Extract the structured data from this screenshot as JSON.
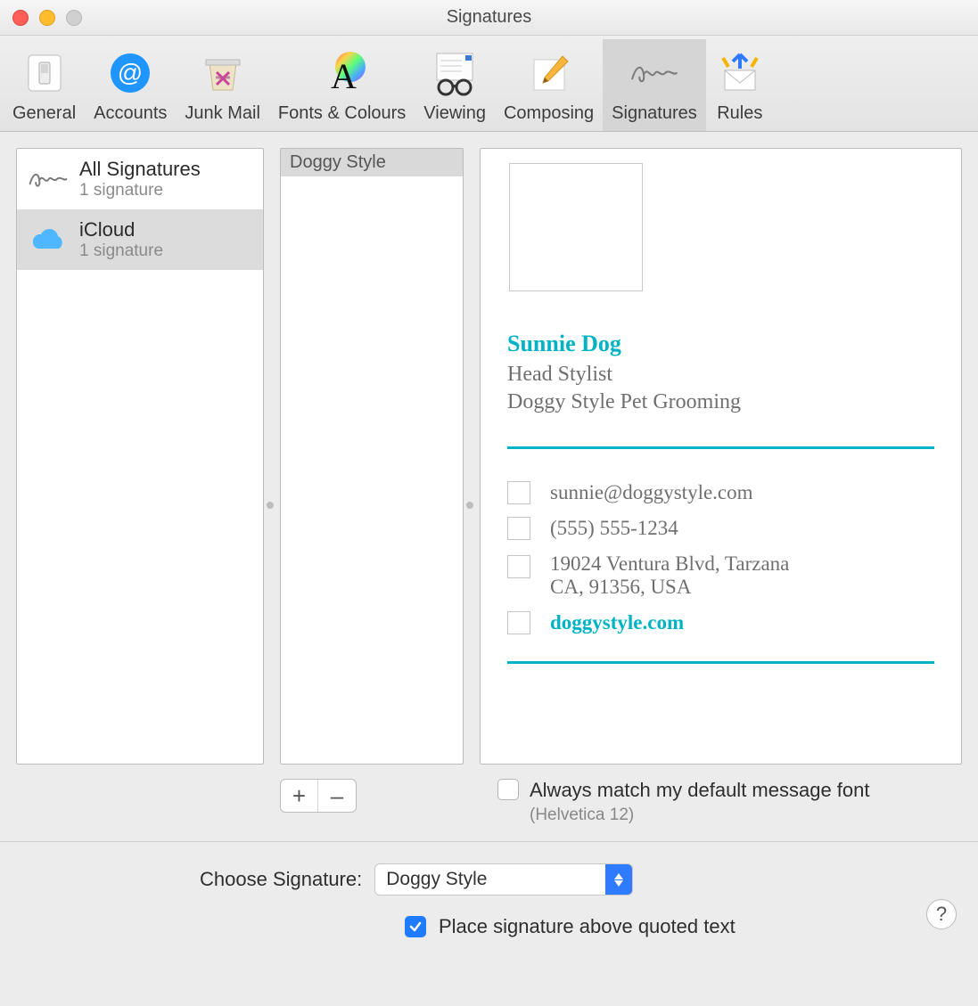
{
  "window": {
    "title": "Signatures"
  },
  "toolbar": {
    "items": [
      {
        "label": "General"
      },
      {
        "label": "Accounts"
      },
      {
        "label": "Junk Mail"
      },
      {
        "label": "Fonts & Colours"
      },
      {
        "label": "Viewing"
      },
      {
        "label": "Composing"
      },
      {
        "label": "Signatures"
      },
      {
        "label": "Rules"
      }
    ],
    "active_index": 6
  },
  "accounts_panel": {
    "rows": [
      {
        "title": "All Signatures",
        "subtitle": "1 signature"
      },
      {
        "title": "iCloud",
        "subtitle": "1 signature"
      }
    ],
    "selected_index": 1
  },
  "signature_list": {
    "items": [
      "Doggy Style"
    ],
    "selected_index": 0
  },
  "preview": {
    "name": "Sunnie Dog",
    "role": "Head Stylist",
    "company": "Doggy Style Pet Grooming",
    "email": "sunnie@doggystyle.com",
    "phone": "(555) 555-1234",
    "address_line1": "19024 Ventura Blvd, Tarzana",
    "address_line2": "CA, 91356, USA",
    "website": "doggystyle.com"
  },
  "buttons": {
    "add": "+",
    "remove": "–"
  },
  "match_font": {
    "label": "Always match my default message font",
    "hint": "(Helvetica 12)",
    "checked": false
  },
  "choose": {
    "label": "Choose Signature:",
    "value": "Doggy Style"
  },
  "place_above": {
    "label": "Place signature above quoted text",
    "checked": true
  },
  "help": "?"
}
